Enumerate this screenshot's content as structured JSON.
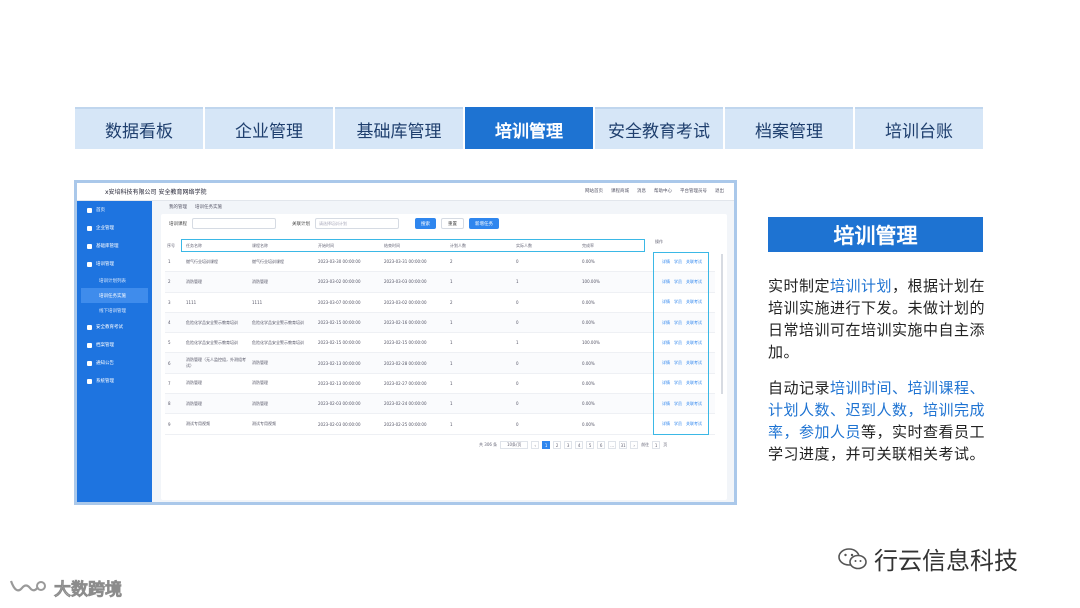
{
  "topnav": {
    "tabs": [
      {
        "label": "数据看板"
      },
      {
        "label": "企业管理"
      },
      {
        "label": "基础库管理"
      },
      {
        "label": "培训管理"
      },
      {
        "label": "安全教育考试"
      },
      {
        "label": "档案管理"
      },
      {
        "label": "培训台账"
      }
    ],
    "active_index": 3
  },
  "app": {
    "brand": "x安培科技有限公司 安全教育网络学院",
    "tools": [
      "网站首页",
      "课程商城",
      "消息",
      "帮助中心",
      "平台管理员号",
      "退出"
    ],
    "sidebar": [
      {
        "label": "首页"
      },
      {
        "label": "企业管理"
      },
      {
        "label": "基础库管理"
      },
      {
        "label": "培训管理"
      },
      {
        "label": "安全教育考试"
      },
      {
        "label": "档案管理"
      },
      {
        "label": "通知公告"
      },
      {
        "label": "系统管理"
      }
    ],
    "sidebar_sub": [
      {
        "label": "培训计划列表"
      },
      {
        "label": "培训任务实施"
      },
      {
        "label": "线下培训管理"
      }
    ],
    "breadcrumb": [
      "我的管理",
      "培训任务实施"
    ],
    "filters": {
      "name_label": "培训课程",
      "name_placeholder": "",
      "plan_label": "关联计划",
      "plan_placeholder": "请选择培训计划",
      "search": "搜索",
      "reset": "重置",
      "add": "新增任务"
    },
    "columns": [
      "任务名称",
      "课程名称",
      "开始时间",
      "结束时间",
      "计划人数",
      "实际人数",
      "完成率"
    ],
    "index_header": "序号",
    "ops_header": "操作",
    "ops": [
      "详情",
      "学员",
      "关联考试"
    ],
    "rows": [
      {
        "n": "1",
        "task": "燃气行业培训课程",
        "course": "燃气行业培训课程",
        "start": "2023-03-30 00:00:00",
        "end": "2023-03-31 00:00:00",
        "plan": "2",
        "actual": "0",
        "rate": "0.00%"
      },
      {
        "n": "2",
        "task": "消防管理",
        "course": "消防管理",
        "start": "2023-03-02 00:00:00",
        "end": "2023-03-03 00:00:00",
        "plan": "1",
        "actual": "1",
        "rate": "100.00%"
      },
      {
        "n": "3",
        "task": "1111",
        "course": "1111",
        "start": "2023-03-07 00:00:00",
        "end": "2023-03-02 00:00:00",
        "plan": "2",
        "actual": "0",
        "rate": "0.00%"
      },
      {
        "n": "4",
        "task": "危险化学品安全警示教育培训",
        "course": "危险化学品安全警示教育培训",
        "start": "2023-02-15 00:00:00",
        "end": "2023-02-16 00:00:00",
        "plan": "1",
        "actual": "0",
        "rate": "0.00%"
      },
      {
        "n": "5",
        "task": "危险化学品安全警示教育培训",
        "course": "危险化学品安全警示教育培训",
        "start": "2023-02-15 00:00:00",
        "end": "2023-02-15 00:00:00",
        "plan": "1",
        "actual": "1",
        "rate": "100.00%"
      },
      {
        "n": "6",
        "task": "消防管理（无人监控组，外测组考试）",
        "course": "消防管理",
        "start": "2023-02-13 00:00:00",
        "end": "2023-02-28 00:00:00",
        "plan": "1",
        "actual": "0",
        "rate": "0.00%"
      },
      {
        "n": "7",
        "task": "消防管理",
        "course": "消防管理",
        "start": "2023-02-13 00:00:00",
        "end": "2023-02-27 00:00:00",
        "plan": "1",
        "actual": "0",
        "rate": "0.00%"
      },
      {
        "n": "8",
        "task": "消防管理",
        "course": "消防管理",
        "start": "2023-02-03 00:00:00",
        "end": "2023-02-24 00:00:00",
        "plan": "1",
        "actual": "0",
        "rate": "0.00%"
      },
      {
        "n": "9",
        "task": "测试专用视频",
        "course": "测试专用视频",
        "start": "2023-02-03 00:00:00",
        "end": "2023-02-25 00:00:00",
        "plan": "1",
        "actual": "0",
        "rate": "0.00%"
      }
    ],
    "pager": {
      "total": "共 306 条",
      "page_size": "10条/页",
      "pages": [
        "1",
        "2",
        "3",
        "4",
        "5",
        "6",
        "...",
        "31"
      ],
      "current": "1",
      "goto_label": "前往",
      "goto_value": "1",
      "goto_suffix": "页"
    }
  },
  "callout_title": "培训管理",
  "desc1": [
    {
      "t": "实时制定",
      "hl": false
    },
    {
      "t": "培训计划",
      "hl": true
    },
    {
      "t": "，根据计划在培训实施进行下发。未做计划的日常培训可在培训实施中自主添加。",
      "hl": false
    }
  ],
  "desc2": [
    {
      "t": "自动记录",
      "hl": false
    },
    {
      "t": "培训时间、培训课程、计划人数、迟到人数，培训完成率，参加人员",
      "hl": true
    },
    {
      "t": "等，实时查看员工学习进度，并可关联相关考试。",
      "hl": false
    }
  ],
  "watermark_right": "行云信息科技",
  "watermark_left": "大数跨境",
  "colors": {
    "accent": "#1e73d2",
    "tab_bg": "#d6e6f7",
    "sidebar": "#1e74e0",
    "highlight_border": "#3bb8e6"
  }
}
